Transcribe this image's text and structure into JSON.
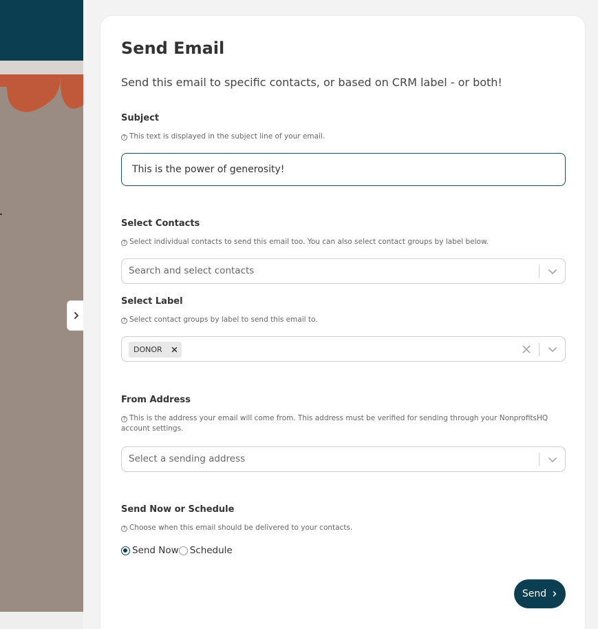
{
  "modal": {
    "title": "Send Email",
    "subtitle": "Send this email to specific contacts, or based on CRM label - or both!"
  },
  "subject": {
    "label": "Subject",
    "help": "This text is displayed in the subject line of your email.",
    "value": "This is the power of generosity!"
  },
  "contacts": {
    "label": "Select Contacts",
    "help": "Select individual contacts to send this email too. You can also select contact groups by label below.",
    "placeholder": "Search and select contacts"
  },
  "label_select": {
    "label": "Select Label",
    "help": "Select contact groups by label to send this email to.",
    "selected": [
      "DONOR"
    ]
  },
  "from_address": {
    "label": "From Address",
    "help": "This is the address your email will come from. This address must be verified for sending through your NonprofitsHQ account settings.",
    "placeholder": "Select a sending address"
  },
  "schedule": {
    "label": "Send Now or Schedule",
    "help": "Choose when this email should be delivered to your contacts.",
    "options": [
      "Send Now",
      "Schedule"
    ],
    "selected": "Send Now"
  },
  "actions": {
    "send_label": "Send"
  },
  "colors": {
    "primary": "#0c3e52",
    "background_overlay": "#9a8c82",
    "awning": "#c0583a"
  },
  "icons": {
    "help": "question-circle-icon",
    "chevron": "chevron-down-icon",
    "clear": "close-icon",
    "drawer_toggle": "chevron-right-icon",
    "send": "chevron-right-icon"
  }
}
